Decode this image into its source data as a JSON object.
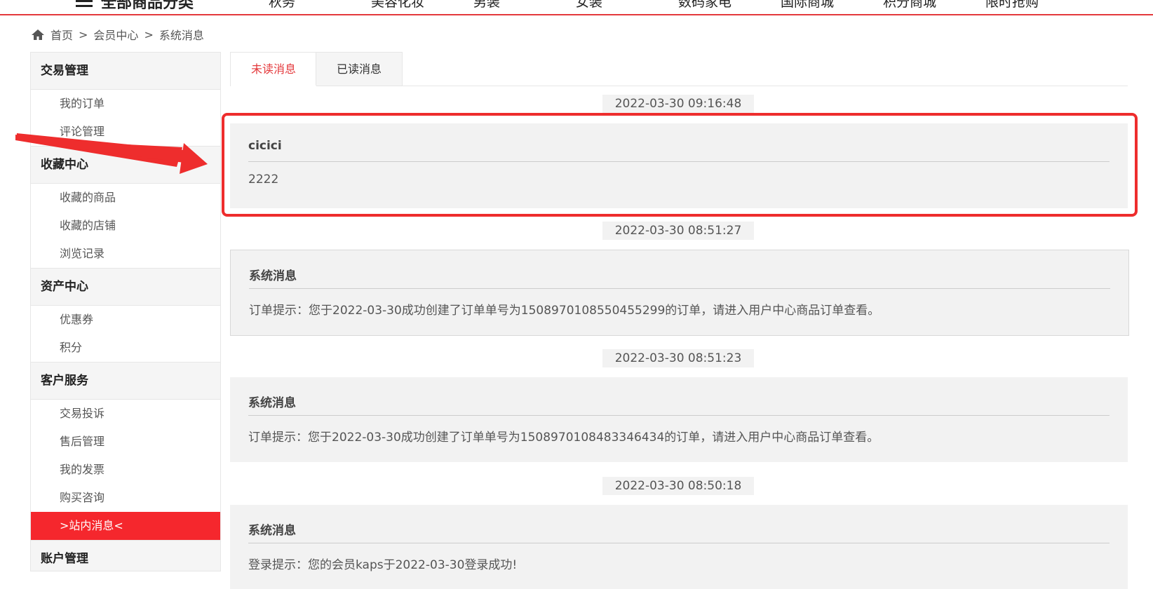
{
  "topnav": {
    "all_categories": "全部商品分类",
    "links": [
      "秋务",
      "美容化妆",
      "男装",
      "女装",
      "数码家电",
      "国际商城",
      "积分商城",
      "限时抢购"
    ]
  },
  "breadcrumb": {
    "home": "首页",
    "sep": ">",
    "member_center": "会员中心",
    "current": "系统消息"
  },
  "sidebar": {
    "sections": [
      {
        "title": "交易管理",
        "items": [
          "我的订单",
          "评论管理"
        ]
      },
      {
        "title": "收藏中心",
        "items": [
          "收藏的商品",
          "收藏的店铺",
          "浏览记录"
        ]
      },
      {
        "title": "资产中心",
        "items": [
          "优惠券",
          "积分"
        ]
      },
      {
        "title": "客户服务",
        "items": [
          "交易投诉",
          "售后管理",
          "我的发票",
          "购买咨询",
          ">站内消息<"
        ]
      },
      {
        "title": "账户管理",
        "items": []
      }
    ]
  },
  "tabs": {
    "unread": "未读消息",
    "read": "已读消息"
  },
  "messages": [
    {
      "time": "2022-03-30 09:16:48",
      "title": "cicici",
      "body": "2222"
    },
    {
      "time": "2022-03-30 08:51:27",
      "title": "系统消息",
      "body": "订单提示：您于2022-03-30成功创建了订单单号为1508970108550455299的订单，请进入用户中心商品订单查看。"
    },
    {
      "time": "2022-03-30 08:51:23",
      "title": "系统消息",
      "body": "订单提示：您于2022-03-30成功创建了订单单号为1508970108483346434的订单，请进入用户中心商品订单查看。"
    },
    {
      "time": "2022-03-30 08:50:18",
      "title": "系统消息",
      "body": "登录提示：您的会员kaps于2022-03-30登录成功!"
    }
  ],
  "colors": {
    "accent": "#e4393c",
    "active_bg": "#f5272d",
    "annotation": "#ee2d2d"
  }
}
